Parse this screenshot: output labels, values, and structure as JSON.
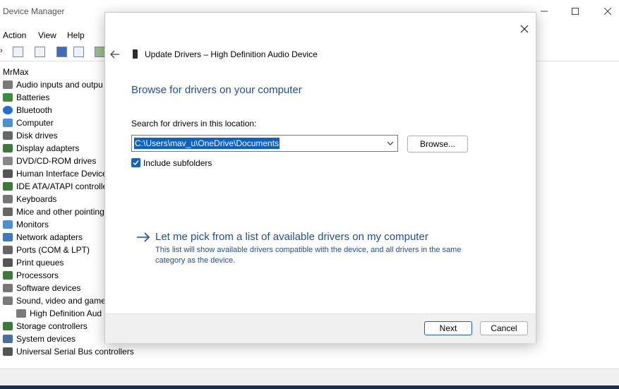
{
  "device_manager": {
    "title": "Device Manager",
    "menu": [
      "Action",
      "View",
      "Help"
    ],
    "tree": {
      "root": "MrMax",
      "items": [
        {
          "label": "Audio inputs and outpu",
          "icon": "speaker-icon"
        },
        {
          "label": "Batteries",
          "icon": "battery-icon"
        },
        {
          "label": "Bluetooth",
          "icon": "bluetooth-icon"
        },
        {
          "label": "Computer",
          "icon": "computer-icon"
        },
        {
          "label": "Disk drives",
          "icon": "disk-icon"
        },
        {
          "label": "Display adapters",
          "icon": "display-icon"
        },
        {
          "label": "DVD/CD-ROM drives",
          "icon": "dvd-icon"
        },
        {
          "label": "Human Interface Device",
          "icon": "hid-icon"
        },
        {
          "label": "IDE ATA/ATAPI controlle",
          "icon": "ide-icon"
        },
        {
          "label": "Keyboards",
          "icon": "keyboard-icon"
        },
        {
          "label": "Mice and other pointing",
          "icon": "mouse-icon"
        },
        {
          "label": "Monitors",
          "icon": "monitor-icon"
        },
        {
          "label": "Network adapters",
          "icon": "network-icon"
        },
        {
          "label": "Ports (COM & LPT)",
          "icon": "port-icon"
        },
        {
          "label": "Print queues",
          "icon": "printer-icon"
        },
        {
          "label": "Processors",
          "icon": "processor-icon"
        },
        {
          "label": "Software devices",
          "icon": "software-icon"
        },
        {
          "label": "Sound, video and game",
          "icon": "speaker-icon"
        },
        {
          "label": "High Definition Aud",
          "icon": "speaker-icon",
          "child": true
        },
        {
          "label": "Storage controllers",
          "icon": "storage-icon"
        },
        {
          "label": "System devices",
          "icon": "system-icon"
        },
        {
          "label": "Universal Serial Bus controllers",
          "icon": "usb-icon"
        }
      ]
    }
  },
  "dialog": {
    "header": "Update Drivers – High Definition Audio Device",
    "heading": "Browse for drivers on your computer",
    "search_label": "Search for drivers in this location:",
    "path_value": "C:\\Users\\mav_u\\OneDrive\\Documents",
    "browse_label": "Browse...",
    "include_subfolders_label": "Include subfolders",
    "include_subfolders_checked": true,
    "pick_title": "Let me pick from a list of available drivers on my computer",
    "pick_desc": "This list will show available drivers compatible with the device, and all drivers in the same category as the device.",
    "next_label": "Next",
    "cancel_label": "Cancel"
  },
  "colors": {
    "accent_blue": "#1f4e96",
    "selection_blue": "#0a62c5",
    "checkbox_blue": "#1b62b3"
  }
}
